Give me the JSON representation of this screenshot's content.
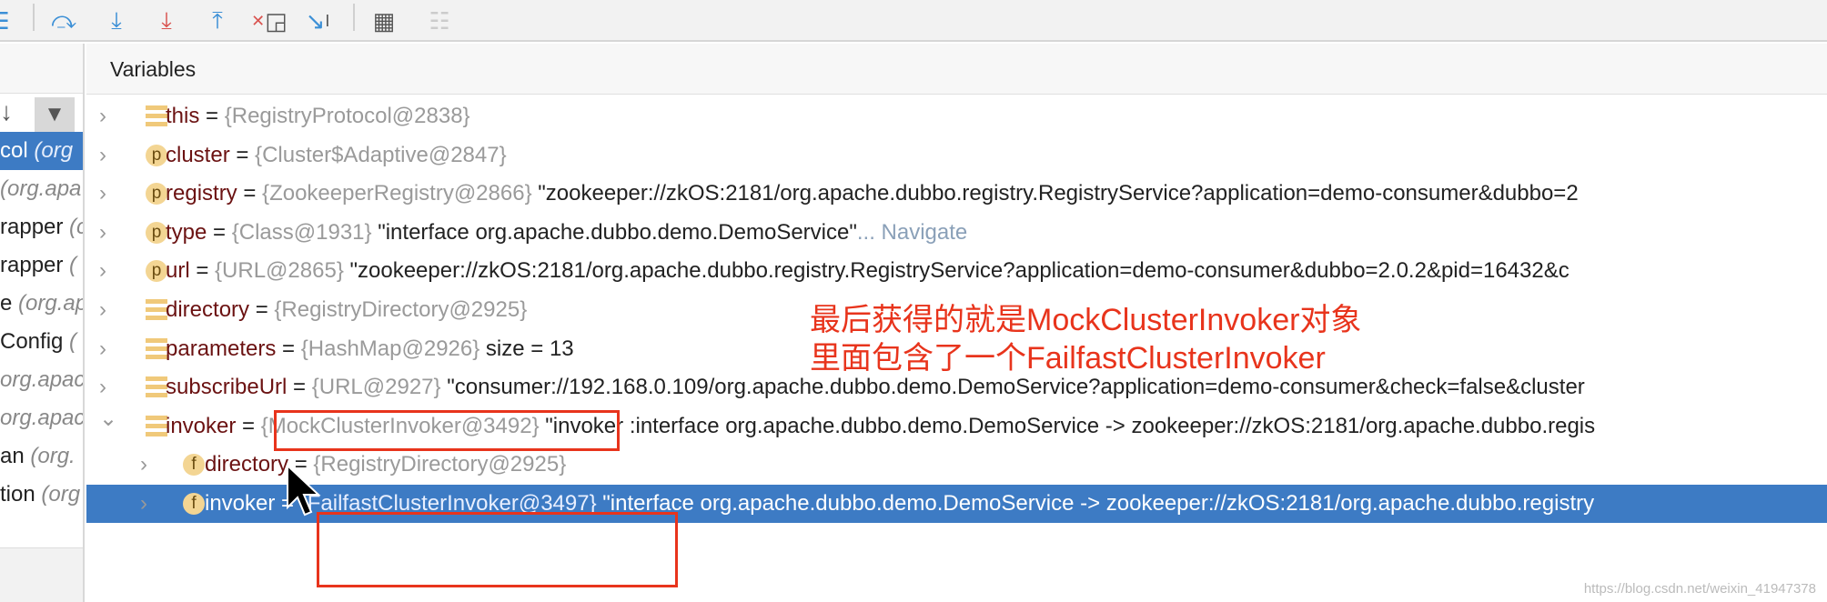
{
  "toolbar": {
    "icons": [
      "list-icon",
      "step-over-icon",
      "step-into-icon",
      "force-step-into-icon",
      "step-out-icon",
      "drop-frame-icon",
      "run-to-cursor-icon",
      "evaluate-expression-icon",
      "trace-icon"
    ]
  },
  "left_panel": {
    "items": [
      {
        "text": "col ",
        "italic": "(org",
        "selected": true
      },
      {
        "text": "",
        "italic": "(org.apa"
      },
      {
        "text": "rapper ",
        "italic": "(c"
      },
      {
        "text": "rapper ",
        "italic": "("
      },
      {
        "text": "e ",
        "italic": "(org.ap"
      },
      {
        "text": "Config ",
        "italic": "("
      },
      {
        "text": "",
        "italic": "org.apac"
      },
      {
        "text": "",
        "italic": "org.apac"
      },
      {
        "text": "an ",
        "italic": "(org."
      },
      {
        "text": "tion ",
        "italic": "(org"
      }
    ]
  },
  "variables": {
    "title": "Variables",
    "rows": [
      {
        "icon": "lines",
        "name": "this",
        "ref": "{RegistryProtocol@2838}",
        "value": ""
      },
      {
        "icon": "p",
        "name": "cluster",
        "ref": "{Cluster$Adaptive@2847}",
        "value": ""
      },
      {
        "icon": "p",
        "name": "registry",
        "ref": "{ZookeeperRegistry@2866}",
        "value": " \"zookeeper://zkOS:2181/org.apache.dubbo.registry.RegistryService?application=demo-consumer&dubbo=2"
      },
      {
        "icon": "p",
        "name": "type",
        "ref": "{Class@1931}",
        "value": " \"interface org.apache.dubbo.demo.DemoService\"",
        "link": "... Navigate"
      },
      {
        "icon": "p",
        "name": "url",
        "ref": "{URL@2865}",
        "value": " \"zookeeper://zkOS:2181/org.apache.dubbo.registry.RegistryService?application=demo-consumer&dubbo=2.0.2&pid=16432&c"
      },
      {
        "icon": "lines",
        "name": "directory",
        "ref": "{RegistryDirectory@2925}",
        "value": ""
      },
      {
        "icon": "lines",
        "name": "parameters",
        "ref": "{HashMap@2926}",
        "value": "  size = 13"
      },
      {
        "icon": "lines",
        "name": "subscribeUrl",
        "ref": "{URL@2927}",
        "value": " \"consumer://192.168.0.109/org.apache.dubbo.demo.DemoService?application=demo-consumer&check=false&cluster"
      },
      {
        "icon": "lines",
        "name": "invoker",
        "ref": "{MockClusterInvoker@3492}",
        "value": " \"invoker :interface org.apache.dubbo.demo.DemoService -> zookeeper://zkOS:2181/org.apache.dubbo.regis",
        "expanded": true
      },
      {
        "icon": "f",
        "name": "directory",
        "ref": "{RegistryDirectory@2925}",
        "value": "",
        "child": true
      },
      {
        "icon": "f",
        "name": "invoker",
        "ref": "{FailfastClusterInvoker@3497}",
        "value": " \"interface org.apache.dubbo.demo.DemoService -> zookeeper://zkOS:2181/org.apache.dubbo.registry",
        "child": true,
        "selected": true
      }
    ]
  },
  "annotation": {
    "line1": "最后获得的就是MockClusterInvoker对象",
    "line2": "里面包含了一个FailfastClusterInvoker",
    "color": "#e8341c"
  },
  "watermark": "https://blog.csdn.net/weixin_41947378"
}
